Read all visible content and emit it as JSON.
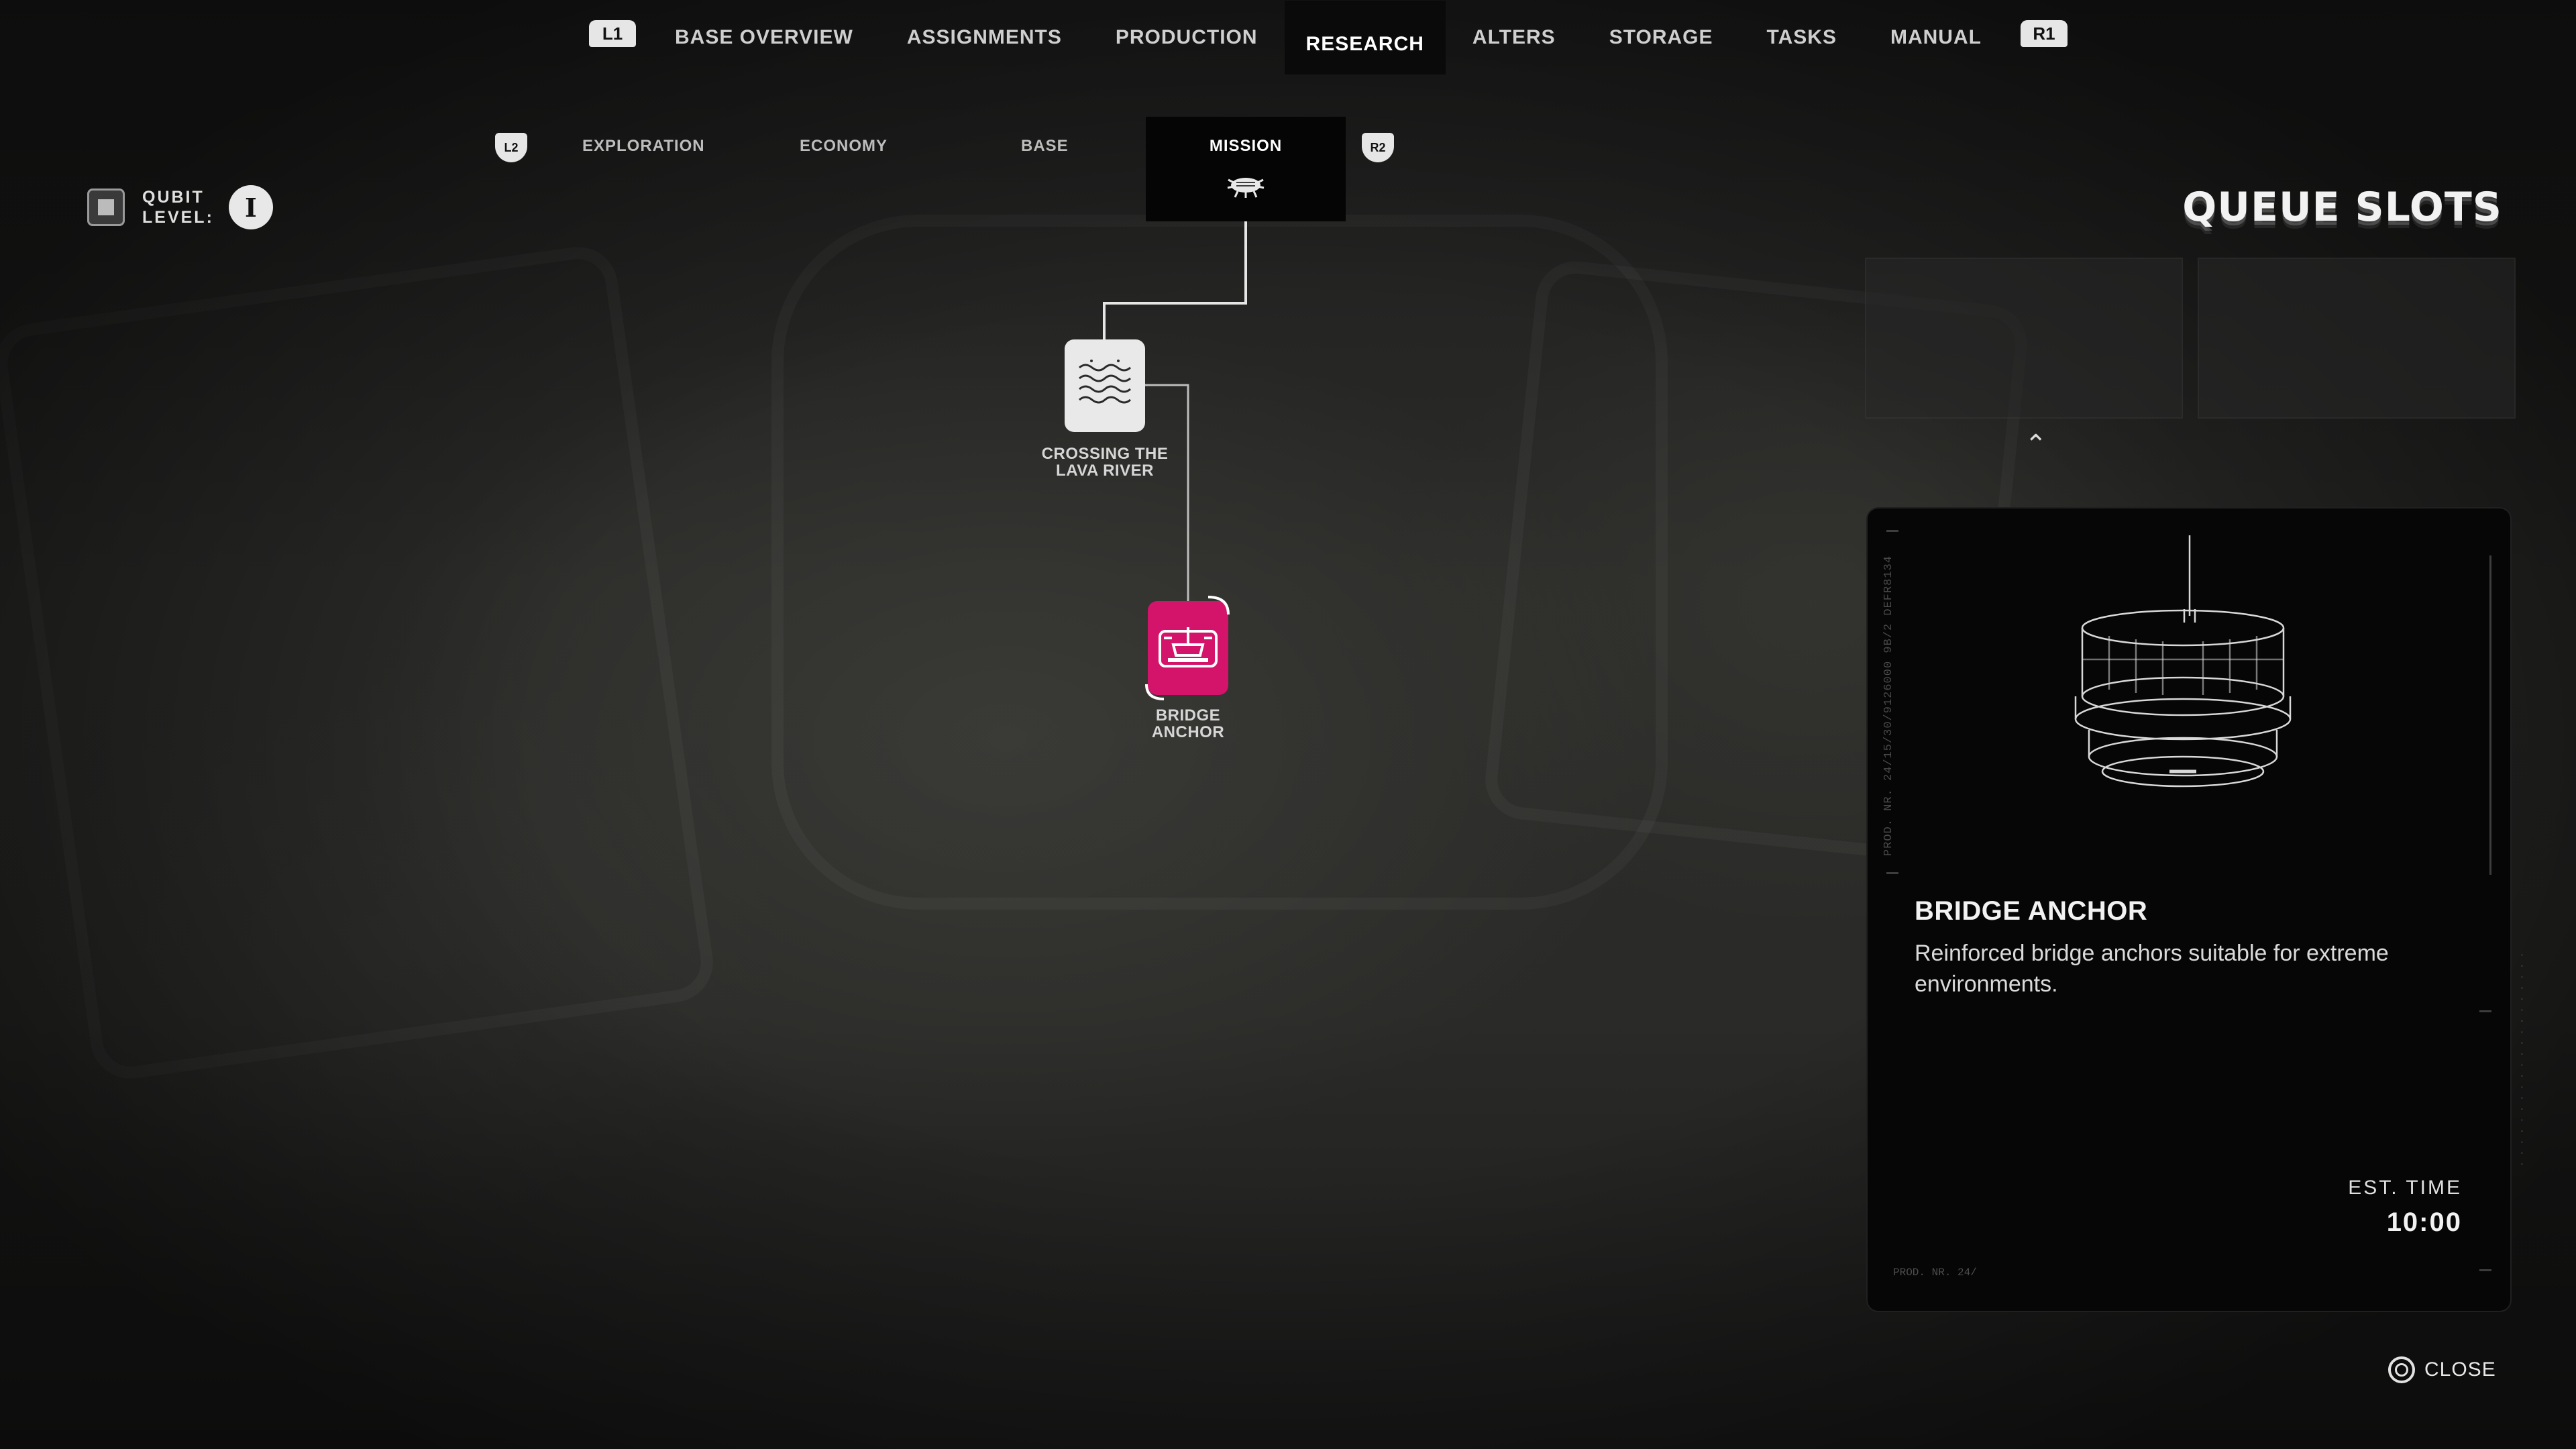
{
  "nav": {
    "left_tag": "L1",
    "right_tag": "R1",
    "items": [
      {
        "label": "BASE OVERVIEW"
      },
      {
        "label": "ASSIGNMENTS"
      },
      {
        "label": "PRODUCTION"
      },
      {
        "label": "RESEARCH",
        "active": true
      },
      {
        "label": "ALTERS"
      },
      {
        "label": "STORAGE"
      },
      {
        "label": "TASKS"
      },
      {
        "label": "MANUAL"
      }
    ]
  },
  "subnav": {
    "left_tag": "L2",
    "right_tag": "R2",
    "items": [
      {
        "label": "EXPLORATION"
      },
      {
        "label": "ECONOMY"
      },
      {
        "label": "BASE"
      },
      {
        "label": "MISSION",
        "active": true,
        "icon": "bug-icon"
      }
    ]
  },
  "qubit": {
    "label_line1": "QUBIT",
    "label_line2": "LEVEL:",
    "level": "I"
  },
  "tree": {
    "nodes": [
      {
        "label_line1": "CROSSING THE",
        "label_line2": "LAVA RIVER",
        "icon": "lava-waves-icon"
      },
      {
        "label_line1": "BRIDGE",
        "label_line2": "ANCHOR",
        "icon": "bridge-anchor-icon",
        "selected": true,
        "color": "#d4136a"
      }
    ]
  },
  "queue": {
    "title": "QUEUE SLOTS"
  },
  "detail": {
    "side_text": "PROD. NR. 24/15/30/9126000 9B/2  DEFR8134",
    "title": "BRIDGE ANCHOR",
    "description": "Reinforced bridge anchors suitable for extreme environments.",
    "est_time_label": "EST. TIME",
    "est_time_value": "10:00",
    "prod_nr": "PROD. NR. 24/"
  },
  "footer": {
    "close_label": "CLOSE"
  },
  "colors": {
    "accent": "#d4136a",
    "panel": "#060606"
  }
}
